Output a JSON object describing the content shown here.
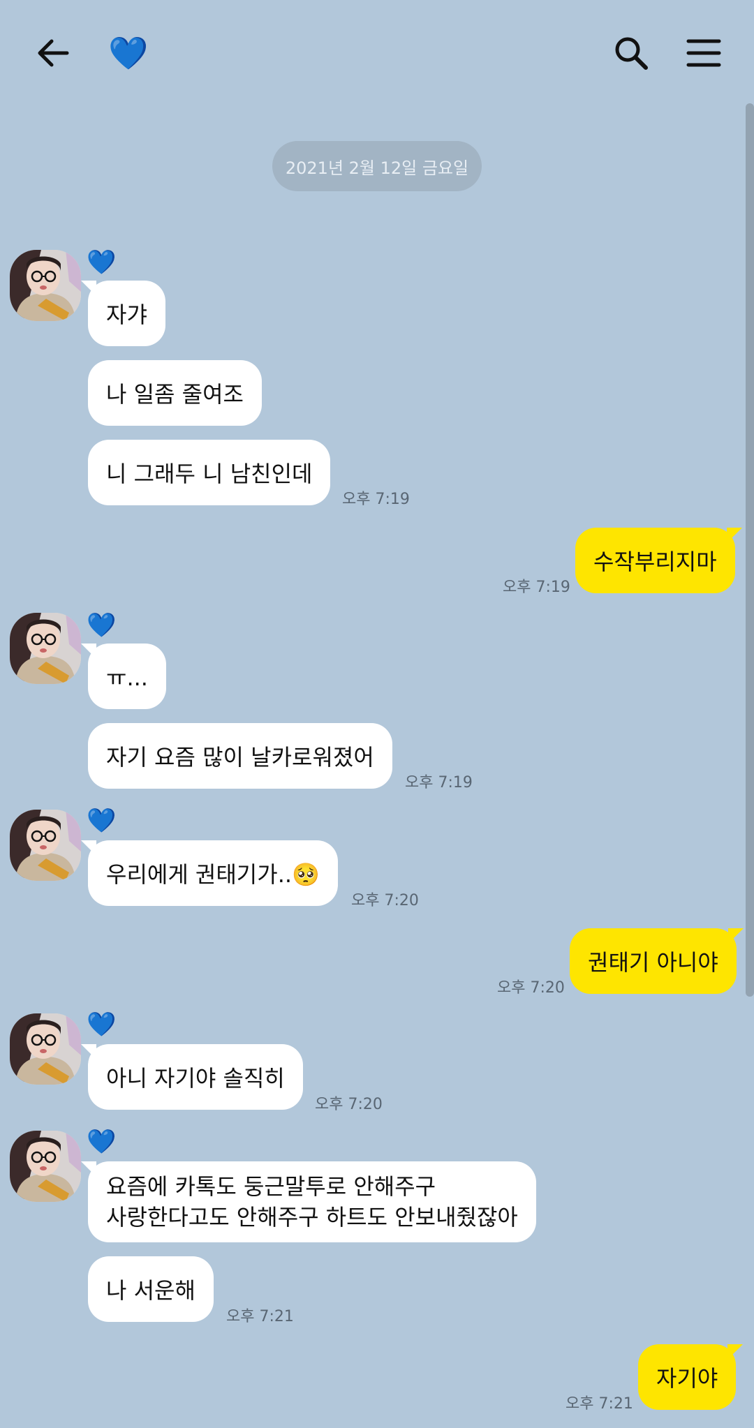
{
  "header": {
    "back_icon": "arrow-left-icon",
    "title_icon": "blue-heart-emoji",
    "title_glyph": "💙",
    "search_icon": "search-icon",
    "menu_icon": "hamburger-menu-icon"
  },
  "date_divider": "2021년 2월 12일 금요일",
  "sender": {
    "name_glyph": "💙",
    "avatar": "profile-photo"
  },
  "messages": [
    {
      "from": "them",
      "text": "자갸"
    },
    {
      "from": "them",
      "text": "나 일좀 줄여조"
    },
    {
      "from": "them",
      "text": "니 그래두 니 남친인데",
      "time": "오후 7:19"
    },
    {
      "from": "me",
      "text": "수작부리지마",
      "time": "오후 7:19"
    },
    {
      "from": "them",
      "text": "ㅠ..."
    },
    {
      "from": "them",
      "text": "자기 요즘 많이 날카로워졌어",
      "time": "오후 7:19"
    },
    {
      "from": "them",
      "text": "우리에게 권태기가..🥺",
      "time": "오후 7:20"
    },
    {
      "from": "me",
      "text": "권태기 아니야",
      "time": "오후 7:20"
    },
    {
      "from": "them",
      "text": "아니 자기야 솔직히",
      "time": "오후 7:20"
    },
    {
      "from": "them",
      "lines": [
        "요즘에 카톡도 둥근말투로 안해주구",
        "사랑한다고도 안해주구 하트도 안보내줬잖아"
      ]
    },
    {
      "from": "them",
      "text": "나 서운해",
      "time": "오후 7:21"
    },
    {
      "from": "me",
      "text": "자기야",
      "time": "오후 7:21"
    }
  ],
  "colors": {
    "background": "#b2c7da",
    "incoming_bubble": "#ffffff",
    "outgoing_bubble": "#fee500",
    "heart": "#1e9df0"
  }
}
